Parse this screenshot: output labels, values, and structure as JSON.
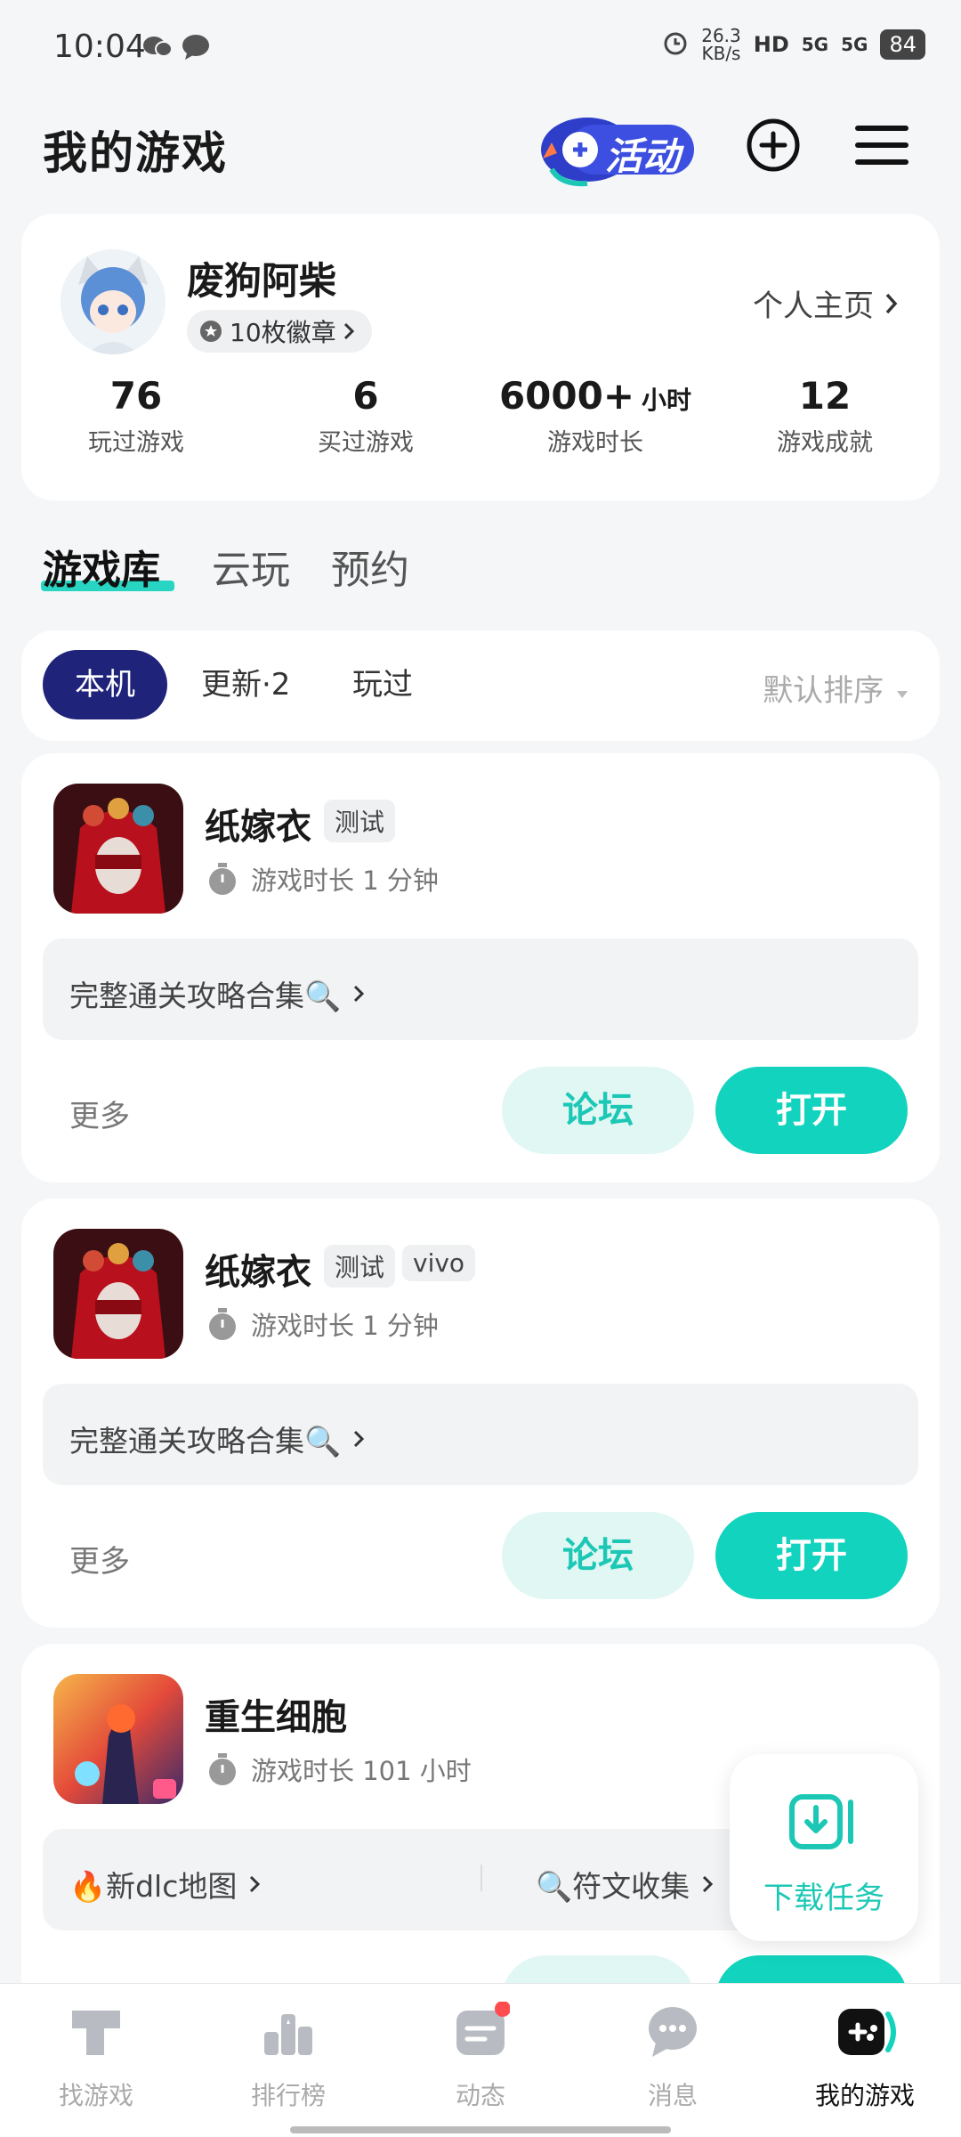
{
  "status_bar": {
    "time": "10:04",
    "net_speed": "26.3",
    "net_unit": "KB/s",
    "hd": "HD",
    "sig1": "5G",
    "sig2": "5G",
    "battery": "84"
  },
  "header": {
    "title": "我的游戏",
    "activity_label": "活动"
  },
  "profile": {
    "name": "废狗阿柴",
    "medals": "10枚徽章",
    "homepage": "个人主页",
    "stats": [
      {
        "value": "76",
        "unit": "",
        "label": "玩过游戏"
      },
      {
        "value": "6",
        "unit": "",
        "label": "买过游戏"
      },
      {
        "value": "6000+",
        "unit": "小时",
        "label": "游戏时长"
      },
      {
        "value": "12",
        "unit": "",
        "label": "游戏成就"
      }
    ]
  },
  "tabs": [
    "游戏库",
    "云玩",
    "预约"
  ],
  "filters": {
    "chips": [
      "本机",
      "更新·2",
      "玩过"
    ],
    "sort": "默认排序"
  },
  "games": [
    {
      "name": "纸嫁衣",
      "tags": [
        "测试"
      ],
      "playtime": "游戏时长 1 分钟",
      "guides": [
        "完整通关攻略合集🔍"
      ],
      "more": "更多",
      "forum": "论坛",
      "open": "打开"
    },
    {
      "name": "纸嫁衣",
      "tags": [
        "测试",
        "vivo"
      ],
      "playtime": "游戏时长 1 分钟",
      "guides": [
        "完整通关攻略合集🔍"
      ],
      "more": "更多",
      "forum": "论坛",
      "open": "打开"
    },
    {
      "name": "重生细胞",
      "tags": [],
      "playtime": "游戏时长 101 小时",
      "guides": [
        "🔥新dlc地图",
        "🔍符文收集"
      ]
    }
  ],
  "download_task": "下载任务",
  "nav": [
    "找游戏",
    "排行榜",
    "动态",
    "消息",
    "我的游戏"
  ],
  "colors": {
    "accent": "#12d3bd",
    "active_chip": "#1f237a",
    "badge_red": "#ff4d4f"
  }
}
